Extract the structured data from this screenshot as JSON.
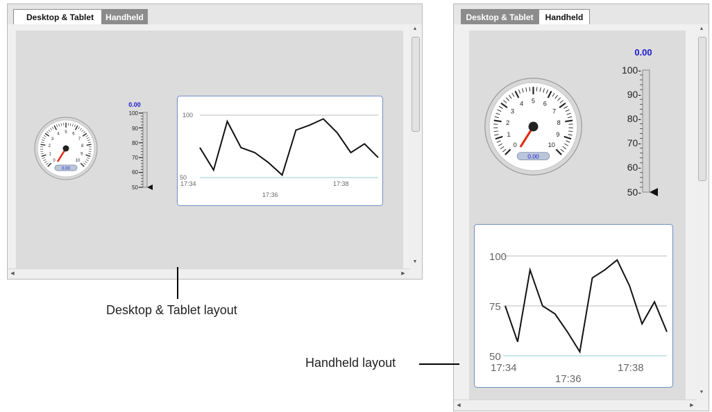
{
  "desktop_panel": {
    "tabs": [
      {
        "label": "Desktop & Tablet",
        "active": true
      },
      {
        "label": "Handheld",
        "active": false
      }
    ],
    "gauge": {
      "value_label": "0.00",
      "ticks": [
        "0",
        "1",
        "2",
        "3",
        "4",
        "5",
        "6",
        "7",
        "8",
        "9",
        "10"
      ]
    },
    "thermometer": {
      "value_label": "0.00",
      "ticks": [
        "100",
        "90",
        "80",
        "70",
        "60",
        "50"
      ]
    },
    "chart_data": {
      "type": "line",
      "y_ticks": [
        "100",
        "50"
      ],
      "x_ticks_top_row": [
        "17:34",
        "17:38"
      ],
      "x_ticks_bottom_row": [
        "17:36"
      ],
      "ylim": [
        50,
        100
      ],
      "values": [
        74,
        56,
        95,
        74,
        70,
        62,
        52,
        88,
        92,
        97,
        86,
        70,
        77,
        66
      ]
    }
  },
  "handheld_panel": {
    "tabs": [
      {
        "label": "Desktop & Tablet",
        "active": false
      },
      {
        "label": "Handheld",
        "active": true
      }
    ],
    "gauge": {
      "value_label": "0.00",
      "ticks": [
        "0",
        "1",
        "2",
        "3",
        "4",
        "5",
        "6",
        "7",
        "8",
        "9",
        "10"
      ]
    },
    "thermometer": {
      "value_label": "0.00",
      "ticks": [
        "100-",
        "90-",
        "80-",
        "70-",
        "60-",
        "50-"
      ]
    },
    "chart_data": {
      "type": "line",
      "y_ticks": [
        "100",
        "75",
        "50"
      ],
      "x_ticks_top_row": [
        "17:34",
        "17:38"
      ],
      "x_ticks_bottom_row": [
        "17:36"
      ],
      "ylim": [
        50,
        100
      ],
      "values": [
        75,
        57,
        93,
        75,
        71,
        62,
        52,
        89,
        93,
        98,
        85,
        66,
        77,
        62
      ]
    }
  },
  "captions": {
    "desktop": "Desktop & Tablet layout",
    "handheld": "Handheld layout"
  },
  "colors": {
    "value_text": "#1a1ad0",
    "needle": "#e02a10",
    "chart_border": "#6d8fc4",
    "tab_inactive": "#8c8c8c"
  }
}
